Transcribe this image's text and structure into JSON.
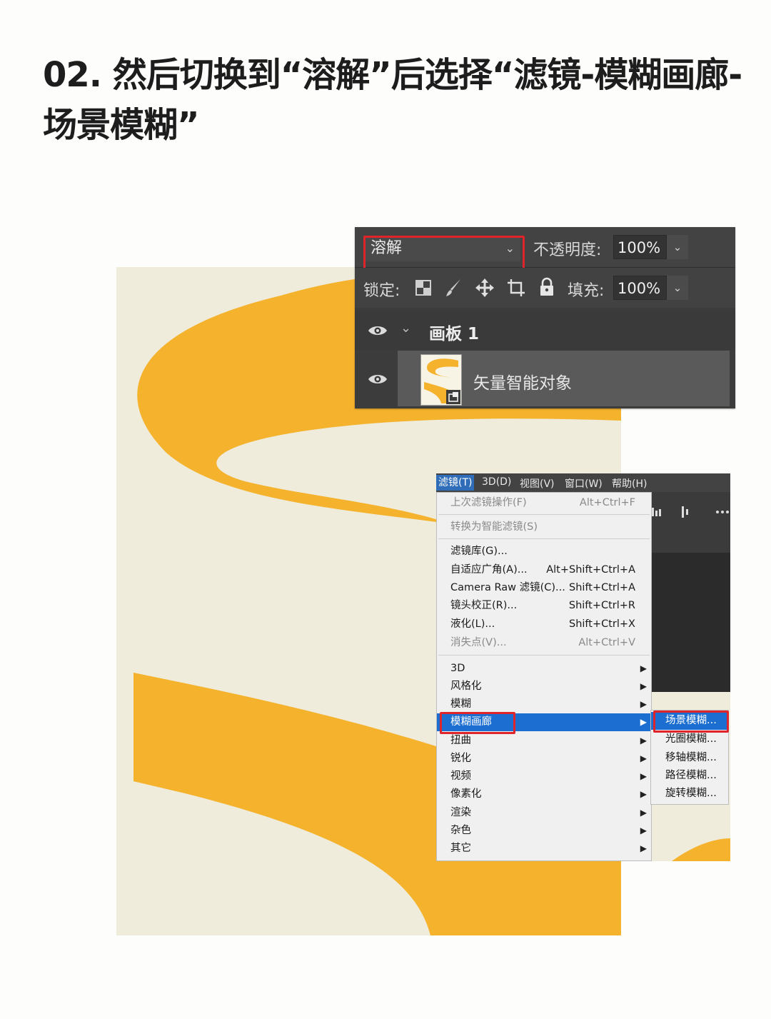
{
  "headline": "02. 然后切换到“溶解”后选择“滤镜-模糊画廊-场景模糊”",
  "layers_panel": {
    "blend_mode": "溶解",
    "opacity_label": "不透明度:",
    "opacity_value": "100%",
    "lock_label": "锁定:",
    "fill_label": "填充:",
    "fill_value": "100%",
    "artboard_name": "画板 1",
    "smart_object_name": "矢量智能对象",
    "icons": [
      "lock-transparent-pixels-icon",
      "lock-brush-icon",
      "lock-move-icon",
      "lock-artboard-icon",
      "lock-all-icon",
      "eye-icon",
      "chevron-down-icon",
      "smart-object-badge-icon"
    ]
  },
  "filter_menu": {
    "menubar": [
      "滤镜(T)",
      "3D(D)",
      "视图(V)",
      "窗口(W)",
      "帮助(H)"
    ],
    "items": [
      {
        "label": "上次滤镜操作(F)",
        "shortcut": "Alt+Ctrl+F",
        "disabled": true
      },
      {
        "label": "转换为智能滤镜(S)",
        "shortcut": "",
        "disabled": true
      },
      {
        "label": "滤镜库(G)...",
        "shortcut": ""
      },
      {
        "label": "自适应广角(A)...",
        "shortcut": "Alt+Shift+Ctrl+A"
      },
      {
        "label": "Camera Raw 滤镜(C)...",
        "shortcut": "Shift+Ctrl+A"
      },
      {
        "label": "镜头校正(R)...",
        "shortcut": "Shift+Ctrl+R"
      },
      {
        "label": "液化(L)...",
        "shortcut": "Shift+Ctrl+X"
      },
      {
        "label": "消失点(V)...",
        "shortcut": "Alt+Ctrl+V",
        "disabled": true
      },
      {
        "label": "3D",
        "submenu": true
      },
      {
        "label": "风格化",
        "submenu": true
      },
      {
        "label": "模糊",
        "submenu": true
      },
      {
        "label": "模糊画廊",
        "submenu": true,
        "highlighted": true
      },
      {
        "label": "扭曲",
        "submenu": true
      },
      {
        "label": "锐化",
        "submenu": true
      },
      {
        "label": "视频",
        "submenu": true
      },
      {
        "label": "像素化",
        "submenu": true
      },
      {
        "label": "渲染",
        "submenu": true
      },
      {
        "label": "杂色",
        "submenu": true
      },
      {
        "label": "其它",
        "submenu": true
      }
    ],
    "submenu_items": [
      {
        "label": "场景模糊...",
        "highlighted": true
      },
      {
        "label": "光圈模糊..."
      },
      {
        "label": "移轴模糊..."
      },
      {
        "label": "路径模糊..."
      },
      {
        "label": "旋转模糊..."
      }
    ]
  },
  "colors": {
    "artboard_bg": "#efecdb",
    "shape_fill": "#f4b22d",
    "highlight_box": "#e0242c",
    "menu_highlight": "#1c6fd1"
  }
}
